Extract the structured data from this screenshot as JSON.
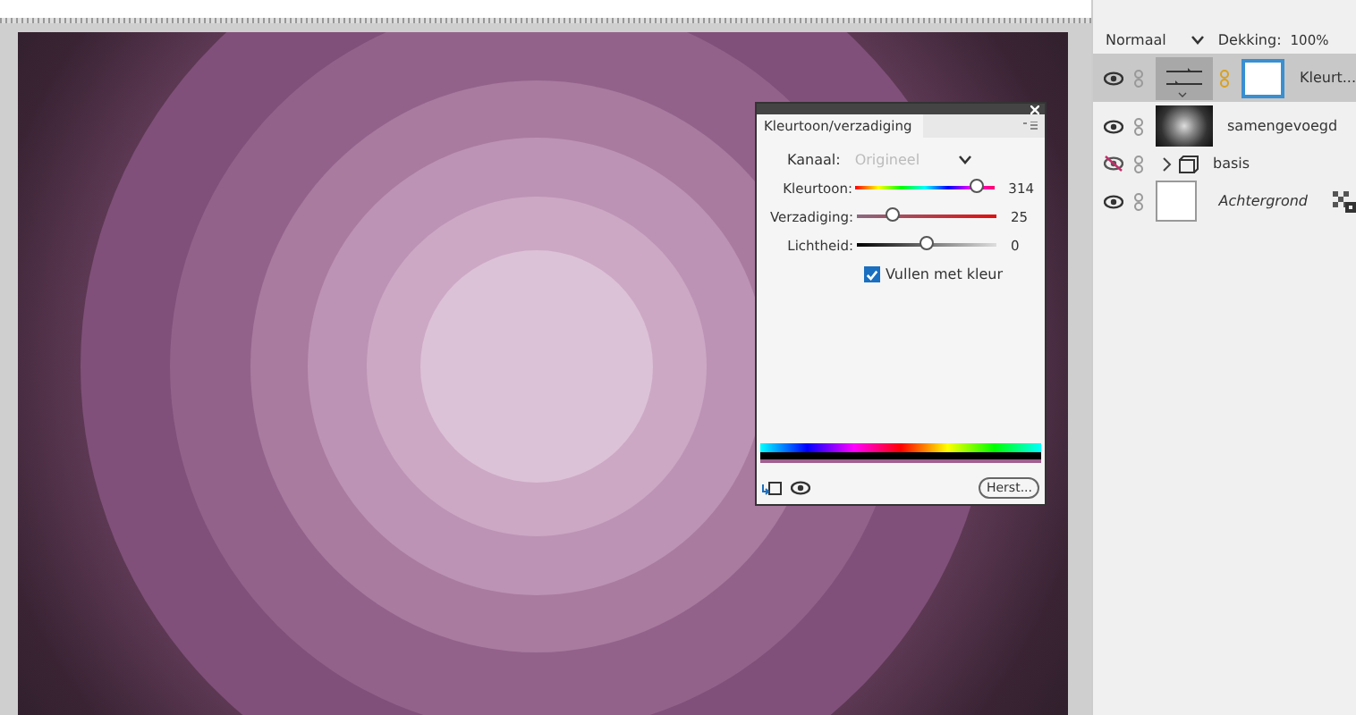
{
  "properties_panel": {
    "tab": "Kleurtoon/verzadiging",
    "channel_label": "Kanaal:",
    "channel": "Origineel",
    "sliders": [
      {
        "label": "Kleurtoon:",
        "kind": "hue",
        "level": 0.87,
        "reading": "314"
      },
      {
        "label": "Verzadiging:",
        "kind": "saturation",
        "level": 0.25,
        "reading": "25"
      },
      {
        "label": "Lichtheid:",
        "kind": "lightness",
        "level": 0.5,
        "reading": "0"
      }
    ],
    "colorize": {
      "label": "Vullen met kleur",
      "checked": true
    },
    "reset_button": "Herst..."
  },
  "layers_panel": {
    "blend_mode": "Normaal",
    "opacity_label": "Dekking:",
    "opacity": "100%",
    "layers": [
      {
        "name": "Kleurt...",
        "kind": "adjustment",
        "visible": true,
        "selected": true
      },
      {
        "name": "samengevoegd",
        "kind": "image",
        "visible": true,
        "selected": false
      },
      {
        "name": "basis",
        "kind": "group",
        "visible": false,
        "selected": false
      },
      {
        "name": "Achtergrond",
        "kind": "background",
        "visible": true,
        "selected": false
      }
    ]
  }
}
